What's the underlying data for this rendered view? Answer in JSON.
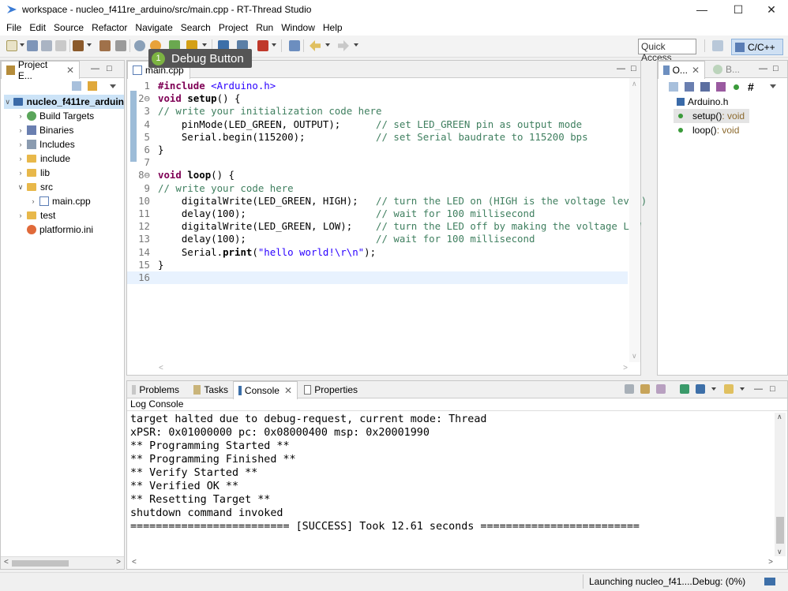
{
  "window": {
    "title": "workspace - nucleo_f411re_arduino/src/main.cpp - RT-Thread Studio"
  },
  "menu": [
    "File",
    "Edit",
    "Source",
    "Refactor",
    "Navigate",
    "Search",
    "Project",
    "Run",
    "Window",
    "Help"
  ],
  "toolbar": {
    "quick_access": "Quick Access",
    "perspective": "C/C++"
  },
  "tooltip": {
    "badge": "1",
    "text": "Debug Button"
  },
  "project_explorer": {
    "tab": "Project E...",
    "root": "nucleo_f411re_arduin",
    "items": [
      "Build Targets",
      "Binaries",
      "Includes",
      "include",
      "lib",
      "src",
      "main.cpp",
      "test",
      "platformio.ini"
    ]
  },
  "editor": {
    "tab": "main.cpp",
    "lines": [
      {
        "n": "1",
        "parts": [
          [
            "kw",
            "#include "
          ],
          [
            "inc",
            "<Arduino.h>"
          ]
        ]
      },
      {
        "n": "2⊖",
        "parts": [
          [
            "kw",
            "void "
          ],
          [
            "kwb",
            "setup"
          ],
          [
            "p",
            "() {"
          ]
        ]
      },
      {
        "n": "3",
        "parts": [
          [
            "cm",
            "// write your initialization code here"
          ]
        ]
      },
      {
        "n": "4",
        "parts": [
          [
            "p",
            "    pinMode(LED_GREEN, OUTPUT);      "
          ],
          [
            "cm",
            "// set LED_GREEN pin as output mode"
          ]
        ]
      },
      {
        "n": "5",
        "parts": [
          [
            "p",
            "    Serial.begin(115200);            "
          ],
          [
            "cm",
            "// set Serial baudrate to 115200 bps"
          ]
        ]
      },
      {
        "n": "6",
        "parts": [
          [
            "p",
            "}"
          ]
        ]
      },
      {
        "n": "7",
        "parts": []
      },
      {
        "n": "8⊖",
        "parts": [
          [
            "kw",
            "void "
          ],
          [
            "kwb",
            "loop"
          ],
          [
            "p",
            "() {"
          ]
        ]
      },
      {
        "n": "9",
        "parts": [
          [
            "cm",
            "// write your code here"
          ]
        ]
      },
      {
        "n": "10",
        "parts": [
          [
            "p",
            "    digitalWrite(LED_GREEN, HIGH);   "
          ],
          [
            "cm",
            "// turn the LED on (HIGH is the voltage level)"
          ]
        ]
      },
      {
        "n": "11",
        "parts": [
          [
            "p",
            "    delay(100);                      "
          ],
          [
            "cm",
            "// wait for 100 millisecond"
          ]
        ]
      },
      {
        "n": "12",
        "parts": [
          [
            "p",
            "    digitalWrite(LED_GREEN, LOW);    "
          ],
          [
            "cm",
            "// turn the LED off by making the voltage LOW"
          ]
        ]
      },
      {
        "n": "13",
        "parts": [
          [
            "p",
            "    delay(100);                      "
          ],
          [
            "cm",
            "// wait for 100 millisecond"
          ]
        ]
      },
      {
        "n": "14",
        "parts": [
          [
            "p",
            "    Serial."
          ],
          [
            "kwb",
            "print"
          ],
          [
            "p",
            "("
          ],
          [
            "st",
            "\"hello world!\\r\\n\""
          ],
          [
            "p",
            ");"
          ]
        ]
      },
      {
        "n": "15",
        "parts": [
          [
            "p",
            "}"
          ]
        ]
      },
      {
        "n": "16",
        "parts": []
      }
    ]
  },
  "outline": {
    "tabs": [
      "O...",
      "B..."
    ],
    "items": [
      {
        "label": "Arduino.h",
        "type": ""
      },
      {
        "label": "setup()",
        "type": " : void"
      },
      {
        "label": "loop()",
        "type": " : void"
      }
    ]
  },
  "console": {
    "tabs": [
      "Problems",
      "Tasks",
      "Console",
      "Properties"
    ],
    "header": "Log Console",
    "lines": [
      "target halted due to debug-request, current mode: Thread",
      "xPSR: 0x01000000 pc: 0x08000400 msp: 0x20001990",
      "** Programming Started **",
      "** Programming Finished **",
      "** Verify Started **",
      "** Verified OK **",
      "** Resetting Target **",
      "shutdown command invoked",
      "========================= [SUCCESS] Took 12.61 seconds ========================="
    ]
  },
  "status": {
    "text": "Launching nucleo_f41....Debug: (0%)"
  }
}
